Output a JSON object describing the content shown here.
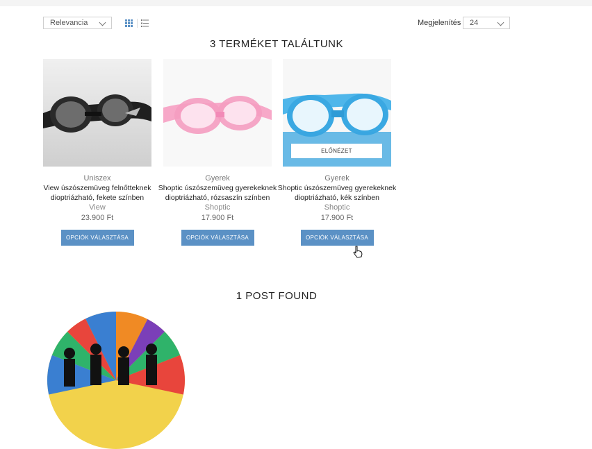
{
  "toolbar": {
    "sort_value": "Relevancia",
    "per_page_label": "Megjelenítés",
    "per_page_value": "24",
    "icons": [
      "grid-view-icon",
      "list-view-icon"
    ]
  },
  "results": {
    "title": "3 TERMÉKET TALÁLTUNK",
    "products": [
      {
        "category": "Uniszex",
        "name": "View úszószemüveg felnőtteknek dioptriázható, fekete színben",
        "brand": "View",
        "price": "23.900 Ft",
        "button": "OPCIÓK VÁLASZTÁSA"
      },
      {
        "category": "Gyerek",
        "name": "Shoptic úszószemüveg gyerekeknek dioptriázható, rózsaszín színben",
        "brand": "Shoptic",
        "price": "17.900 Ft",
        "button": "OPCIÓK VÁLASZTÁSA"
      },
      {
        "category": "Gyerek",
        "name": "Shoptic úszószemüveg gyerekeknek dioptriázható, kék színben",
        "brand": "Shoptic",
        "price": "17.900 Ft",
        "button": "OPCIÓK VÁLASZTÁSA",
        "quickview": "ELŐNÉZET"
      }
    ]
  },
  "posts": {
    "title": "1 POST FOUND"
  },
  "colors": {
    "button_bg": "#5b91c5",
    "topbar": "#f4f4f4"
  }
}
